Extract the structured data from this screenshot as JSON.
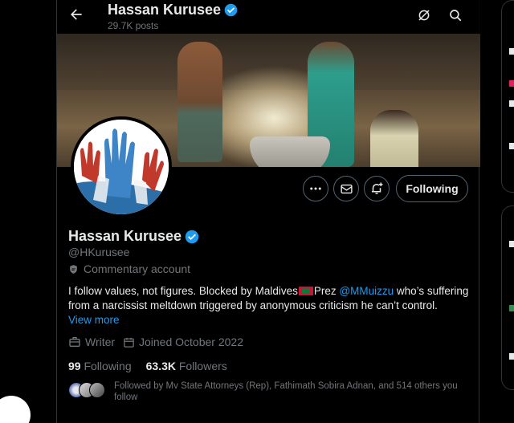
{
  "header": {
    "name": "Hassan Kurusee",
    "posts_count": "29.7K posts"
  },
  "profile": {
    "name": "Hassan Kurusee",
    "handle": "@HKurusee",
    "category": "Commentary account",
    "bio_part1": "I follow values, not figures. Blocked by Maldives",
    "bio_part2": "Prez ",
    "bio_mention": "@MMuizzu",
    "bio_part3": " who’s suffering from a narcissist meltdown triggered by anonymous criticism he can’t control.",
    "view_more": "View more",
    "profession": "Writer",
    "joined": "Joined October 2022",
    "following_count": "99",
    "following_label": "Following",
    "followers_count": "63.3K",
    "followers_label": "Followers",
    "followed_by": "Followed by Mv State Attorneys (Rep), Fathimath Sobira Adnan, and 514 others you follow"
  },
  "buttons": {
    "following": "Following"
  },
  "colors": {
    "accent": "#1d9bf0",
    "muted": "#71767b",
    "border": "#2f3336"
  }
}
